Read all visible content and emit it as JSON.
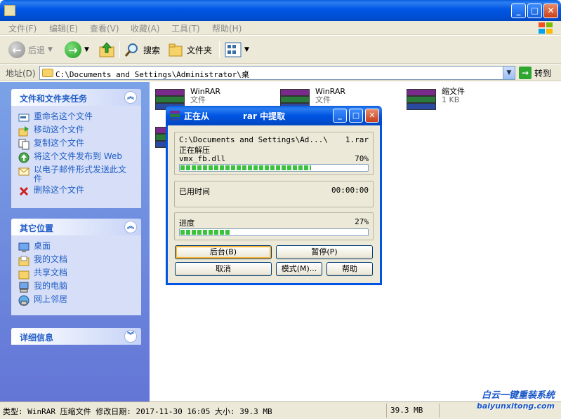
{
  "window": {
    "title": ""
  },
  "menu": [
    "文件(F)",
    "编辑(E)",
    "查看(V)",
    "收藏(A)",
    "工具(T)",
    "帮助(H)"
  ],
  "toolbar": {
    "back": "后退",
    "search": "搜索",
    "folders": "文件夹"
  },
  "address": {
    "label": "地址(D)",
    "path": "C:\\Documents and Settings\\Administrator\\桌",
    "go": "转到"
  },
  "file_tasks": {
    "title": "文件和文件夹任务",
    "items": [
      {
        "label": "重命名这个文件",
        "icon": "rename-icon"
      },
      {
        "label": "移动这个文件",
        "icon": "move-icon"
      },
      {
        "label": "复制这个文件",
        "icon": "copy-icon"
      },
      {
        "label": "将这个文件发布到 Web",
        "icon": "publish-web-icon"
      },
      {
        "label": "以电子邮件形式发送此文件",
        "icon": "email-icon"
      },
      {
        "label": "删除这个文件",
        "icon": "delete-icon"
      }
    ]
  },
  "other_places": {
    "title": "其它位置",
    "items": [
      {
        "label": "桌面",
        "icon": "desktop-icon"
      },
      {
        "label": "我的文档",
        "icon": "my-documents-icon"
      },
      {
        "label": "共享文档",
        "icon": "shared-documents-icon"
      },
      {
        "label": "我的电脑",
        "icon": "my-computer-icon"
      },
      {
        "label": "网上邻居",
        "icon": "network-icon"
      }
    ]
  },
  "details": {
    "title": "详细信息"
  },
  "files": [
    {
      "name": "WinRAR",
      "type": "文件",
      "size": ""
    },
    {
      "name": "WinRAR",
      "type": "文件",
      "size": ""
    },
    {
      "name": "",
      "type": "缩文件",
      "size": "1 KB"
    }
  ],
  "dialog": {
    "title_left": "正在从",
    "title_right": "rar 中提取",
    "archive": "C:\\Documents and Settings\\Ad...\\",
    "archive_end": "1.rar",
    "action": "正在解压",
    "current_file": "vmx_fb.dll",
    "file_percent": "70%",
    "file_progress": 0.7,
    "elapsed_label": "已用时间",
    "elapsed": "00:00:00",
    "progress_label": "进度",
    "total_percent": "27%",
    "total_progress": 0.27,
    "buttons": {
      "background": "后台(B)",
      "pause": "暂停(P)",
      "cancel": "取消",
      "mode": "模式(M)...",
      "help": "帮助"
    }
  },
  "status": {
    "text": "类型: WinRAR 压缩文件 修改日期: 2017-11-30 16:05 大小: 39.3 MB",
    "size": "39.3 MB"
  },
  "watermark": {
    "line1": "白云一键重装系统",
    "line2": "baiyunxitong.com"
  }
}
